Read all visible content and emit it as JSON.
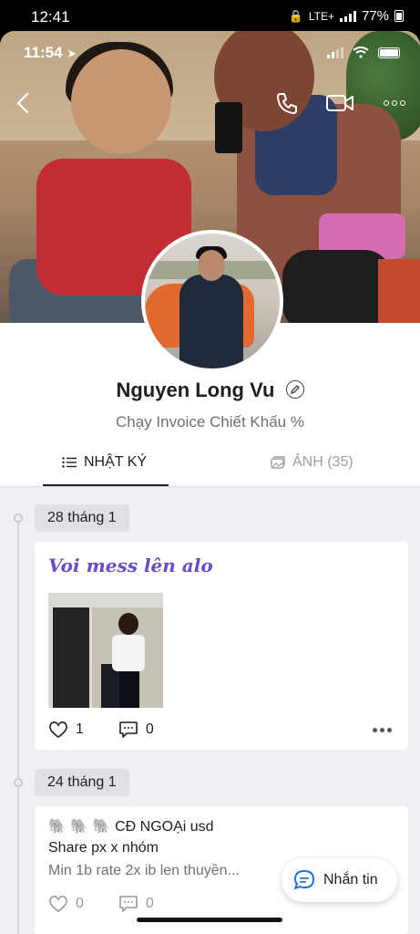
{
  "outer_status": {
    "time": "12:41",
    "network": "LTE+",
    "battery": "77%"
  },
  "inner_status": {
    "time": "11:54"
  },
  "profile": {
    "name": "Nguyen Long Vu",
    "subtitle": "Chạy Invoice Chiết Khấu %"
  },
  "header_icons": [
    "back-icon",
    "phone-icon",
    "video-call-icon",
    "more-icon"
  ],
  "tabs": [
    {
      "label": "NHẬT KÝ",
      "icon": "list-icon",
      "active": true
    },
    {
      "label": "ẢNH (35)",
      "icon": "photo-icon",
      "active": false
    }
  ],
  "posts": [
    {
      "date": "28 tháng 1",
      "title": "Voi mess lên alo",
      "likes": "1",
      "comments": "0"
    },
    {
      "date": "24 tháng 1",
      "lines": [
        "🐘 🐘 🐘 CĐ NGOẠi usd",
        "Share px x nhóm",
        "Min 1b rate 2x ib len thuyền..."
      ],
      "likes": "0",
      "comments": "0"
    }
  ],
  "fab": {
    "label": "Nhắn tin"
  },
  "colors": {
    "accent": "#6c4bc9",
    "fab_icon": "#1e6fe0"
  }
}
